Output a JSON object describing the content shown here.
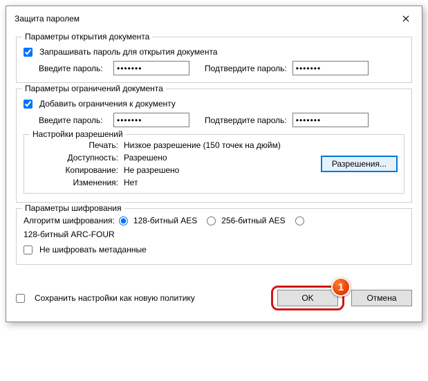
{
  "title": "Защита паролем",
  "open": {
    "legend": "Параметры открытия документа",
    "ask": "Запрашивать пароль для открытия документа",
    "pw_label": "Введите пароль:",
    "pw_val": "•••••••",
    "pw2_label": "Подтвердите пароль:",
    "pw2_val": "•••••••"
  },
  "restrict": {
    "legend": "Параметры ограничений документа",
    "add": "Добавить ограничения к документу",
    "pw_label": "Введите пароль:",
    "pw_val": "•••••••",
    "pw2_label": "Подтвердите пароль:",
    "pw2_val": "•••••••"
  },
  "perm": {
    "legend": "Настройки разрешений",
    "print_k": "Печать:",
    "print_v": "Низкое разрешение (150 точек на дюйм)",
    "access_k": "Доступность:",
    "access_v": "Разрешено",
    "copy_k": "Копирование:",
    "copy_v": "Не разрешено",
    "change_k": "Изменения:",
    "change_v": "Нет",
    "btn": "Разрешения..."
  },
  "enc": {
    "legend": "Параметры шифрования",
    "algo_label": "Алгоритм шифрования:",
    "opt1": "128-битный AES",
    "opt2": "256-битный AES",
    "opt3": "128-битный ARC-FOUR",
    "nometa": "Не шифровать метаданные"
  },
  "footer": {
    "save_policy": "Сохранить настройки как новую политику",
    "ok": "OK",
    "cancel": "Отмена"
  },
  "callout": "1"
}
